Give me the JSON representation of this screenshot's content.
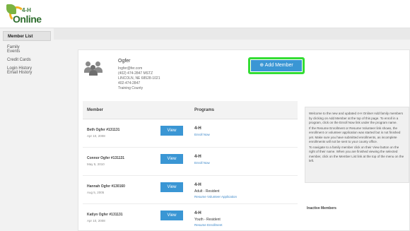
{
  "brand": {
    "logo_text": "Online",
    "logo_mark": "4-H"
  },
  "sidebar": {
    "items": [
      {
        "label": "Member List",
        "active": true
      },
      {
        "label": "Family"
      },
      {
        "label": "Events"
      },
      {
        "label": "Credit Cards"
      },
      {
        "label": "Login History"
      },
      {
        "label": "Email History"
      }
    ]
  },
  "profile": {
    "name": "Ogfer",
    "lines": [
      "Ingfer@fer.com",
      "(402) 474-2847 MSTZ",
      "LINCOLN, NE 68528-1021",
      "402-474-2847",
      "Training County"
    ]
  },
  "actions": {
    "add_member": "Add Member"
  },
  "table": {
    "headers": {
      "member": "Member",
      "programs": "Programs"
    },
    "rows": [
      {
        "name": "Beth Ogfer #131131",
        "date": "Apr 10, 2008",
        "view": "View",
        "program": "4-H",
        "sub": "",
        "link": "Enroll Now"
      },
      {
        "name": "Connor Ogfer #131131",
        "date": "May 5, 2010",
        "view": "View",
        "program": "4-H",
        "sub": "",
        "link": "Enroll Now"
      },
      {
        "name": "Hannah Ogfer #130160",
        "date": "Aug 5, 2005",
        "view": "View",
        "program": "4-H",
        "sub": "Adult - Resident",
        "link": "Resume Volunteer Application"
      },
      {
        "name": "Katlyn Ogfer #131131",
        "date": "Apr 10, 2008",
        "view": "View",
        "program": "4-H",
        "sub": "Youth - Resident",
        "link": "Resume Enrollment"
      }
    ]
  },
  "info": {
    "paragraphs": [
      "Welcome to the new and updated 4-H Online! Add family members by clicking on Add Member at the top of this page. To enroll in a program, click on the Enroll Now link under the program name.",
      "If the Resume Enrollment or Resume Volunteer link shows, the enrollment or volunteer application was started but is not finished yet. Make sure you have submitted enrollments, as incomplete enrollments will not be sent to your county office.",
      "To navigate to a family member click on their View button on the right of their name. When you are finished viewing the selected member, click on the Member List link at the top of the menu on the left."
    ],
    "inactive_title": "Inactive Members"
  },
  "colors": {
    "accent": "#3a96d4",
    "highlight": "#33dd33",
    "link": "#3a86c8"
  }
}
